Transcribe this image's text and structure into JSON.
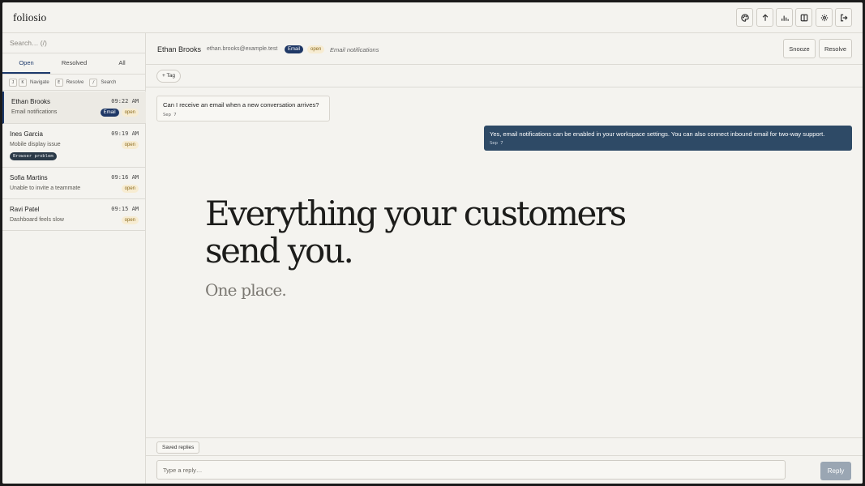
{
  "app": {
    "brand": "foliosio"
  },
  "toolbar": {
    "icons": [
      "palette-icon",
      "arrow-up-icon",
      "bar-chart-icon",
      "columns-icon",
      "gear-icon",
      "logout-icon"
    ]
  },
  "sidebar": {
    "search_placeholder": "Search… (/)",
    "tabs": [
      {
        "label": "Open",
        "active": true
      },
      {
        "label": "Resolved",
        "active": false
      },
      {
        "label": "All",
        "active": false
      }
    ],
    "hints": [
      {
        "keys": [
          "J",
          "K"
        ],
        "label": "Navigate"
      },
      {
        "keys": [
          "E"
        ],
        "label": "Resolve"
      },
      {
        "keys": [
          "/"
        ],
        "label": "Search"
      }
    ],
    "conversations": [
      {
        "name": "Ethan Brooks",
        "time": "09:22 AM",
        "subject": "Email notifications",
        "channel": "Email",
        "status": "open",
        "tag": "",
        "selected": true
      },
      {
        "name": "Ines Garcia",
        "time": "09:19 AM",
        "subject": "Mobile display issue",
        "channel": "",
        "status": "open",
        "tag": "Browser problem",
        "selected": false
      },
      {
        "name": "Sofia Martins",
        "time": "09:16 AM",
        "subject": "Unable to invite a teammate",
        "channel": "",
        "status": "open",
        "tag": "",
        "selected": false
      },
      {
        "name": "Ravi Patel",
        "time": "09:15 AM",
        "subject": "Dashboard feels slow",
        "channel": "",
        "status": "open",
        "tag": "",
        "selected": false
      }
    ]
  },
  "conversation": {
    "name": "Ethan Brooks",
    "email": "ethan.brooks@example.test",
    "channel": "Email",
    "status": "open",
    "subject": "Email notifications",
    "snooze_label": "Snooze",
    "resolve_label": "Resolve",
    "add_tag_label": "+ Tag",
    "messages": [
      {
        "direction": "inbound",
        "text": "Can I receive an email when a new conversation arrives?",
        "date": "Sep 7"
      },
      {
        "direction": "outbound",
        "text": "Yes, email notifications can be enabled in your workspace settings. You can also connect inbound email for two-way support.",
        "date": "Sep 7"
      }
    ]
  },
  "hero": {
    "line1": "Everything your customers",
    "line2": "send you.",
    "line3": "One place."
  },
  "composer": {
    "saved_replies_label": "Saved replies",
    "placeholder": "Type a reply…",
    "reply_label": "Reply"
  },
  "colors": {
    "accent": "#1d3a6b",
    "outbound_bubble": "#2e4a66",
    "open_badge_bg": "#f7ecd2",
    "reply_button_disabled": "#9aa6b3"
  }
}
